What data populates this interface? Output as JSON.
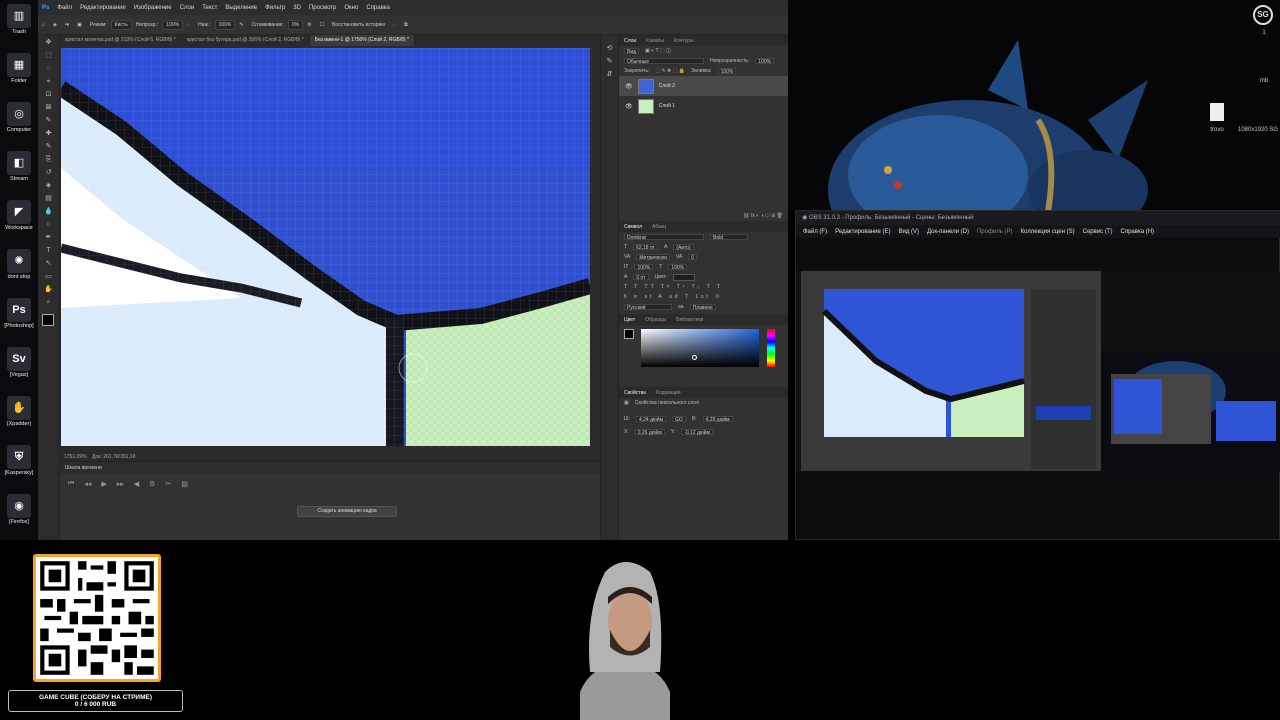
{
  "desktop": {
    "icons": [
      {
        "label": "Trash",
        "glyph": "▥"
      },
      {
        "label": "Folder",
        "glyph": "▦"
      },
      {
        "label": "Computer",
        "glyph": "◎"
      },
      {
        "label": "Stream",
        "glyph": "◧"
      },
      {
        "label": "Workspace",
        "glyph": "◤"
      },
      {
        "label": "dont stop",
        "glyph": "✺"
      },
      {
        "label": "[Photoshop]",
        "glyph": "Ps"
      },
      {
        "label": "[Vegas]",
        "glyph": "Sv"
      },
      {
        "label": "[Xpadder]",
        "glyph": "✋"
      },
      {
        "label": "[Kaspersky]",
        "glyph": "⛨"
      },
      {
        "label": "[Firefox]",
        "glyph": "◉"
      }
    ],
    "right_icons": {
      "count_label": "1",
      "mb_label": "mb",
      "file_label": "trovo",
      "resolution_label": "1080x1920 SG"
    }
  },
  "photoshop": {
    "logo": "Ps",
    "menu": [
      "Файл",
      "Редактирование",
      "Изображение",
      "Слои",
      "Текст",
      "Выделение",
      "Фильтр",
      "3D",
      "Просмотр",
      "Окно",
      "Справка"
    ],
    "options": {
      "mode_label": "Режим:",
      "mode_value": "Кисть",
      "opacity_label": "Непрозр.:",
      "opacity_value": "100%",
      "pressure_label": "Наж.:",
      "pressure_value": "100%",
      "smoothing_label": "Сглаживание:",
      "smoothing_value": "0%",
      "restore_label": "Восстановить историю"
    },
    "tabs": [
      {
        "label": "кристал монетка.psd @ 213% (Слой 6, RGB/8) *",
        "active": false
      },
      {
        "label": "кристал без бутера.psd @ 356% (Слой 2, RGB/8) *",
        "active": false
      },
      {
        "label": "Без имени-1 @ 1750% (Слой 2, RGB/8) *",
        "active": true
      }
    ],
    "status": {
      "zoom": "1751,09%",
      "doc": "Док: 261,7К/391,1К"
    },
    "timeline": {
      "title": "Шкала времени",
      "create_button": "Создать анимацию кадра"
    },
    "layers_panel": {
      "tabs": [
        "Слои",
        "Каналы",
        "Контуры"
      ],
      "kind_label": "Вид",
      "blend_mode": "Обычные",
      "opacity_label": "Непрозрачность:",
      "opacity_value": "100%",
      "lock_label": "Закрепить:",
      "fill_label": "Заливка:",
      "fill_value": "100%",
      "layers": [
        {
          "name": "Слой 2",
          "selected": true,
          "thumb": "#3d63d6"
        },
        {
          "name": "Слой 1",
          "selected": false,
          "thumb": "#c9efc0"
        }
      ]
    },
    "character_panel": {
      "tabs": [
        "Символ",
        "Абзац"
      ],
      "font": "Domkrat",
      "style": "Bold",
      "size": "62,18 пт",
      "leading": "(Авто)",
      "kerning": "Метрически",
      "tracking": "0",
      "scale_v": "100%",
      "scale_h": "100%",
      "baseline": "0 пт",
      "color_label": "Цвет:",
      "language": "Русский",
      "antialias": "Плавное"
    },
    "color_panel": {
      "tabs": [
        "Цвет",
        "Образцы",
        "Библиотеки"
      ]
    },
    "properties_panel": {
      "tabs": [
        "Свойства",
        "Коррекция"
      ],
      "title": "Свойства пиксельного слоя",
      "w": "4,24 дюйм",
      "go_label": "GO",
      "h": "4,29 дюйм",
      "x": "0,26 дюйм",
      "y": "-0,12 дюйм"
    }
  },
  "obs": {
    "title": "OBS 31.0.3 - Профиль: Безымянный - Сцены: Безымянный",
    "menu": [
      "Файл (F)",
      "Редактирование (E)",
      "Вид (V)",
      "Док-панели (D)",
      "Профиль (P)",
      "Коллекция сцен (S)",
      "Сервис (T)",
      "Справка (H)"
    ]
  },
  "overlay": {
    "goal_title": "GAME CUBE (СОБЕРУ НА СТРИМЕ)",
    "goal_progress": "0 / 6 000 RUB"
  },
  "colors": {
    "accent_orange": "#f6a52a",
    "ps_blue": "#2f55d6",
    "light_green": "#c9efc0"
  }
}
